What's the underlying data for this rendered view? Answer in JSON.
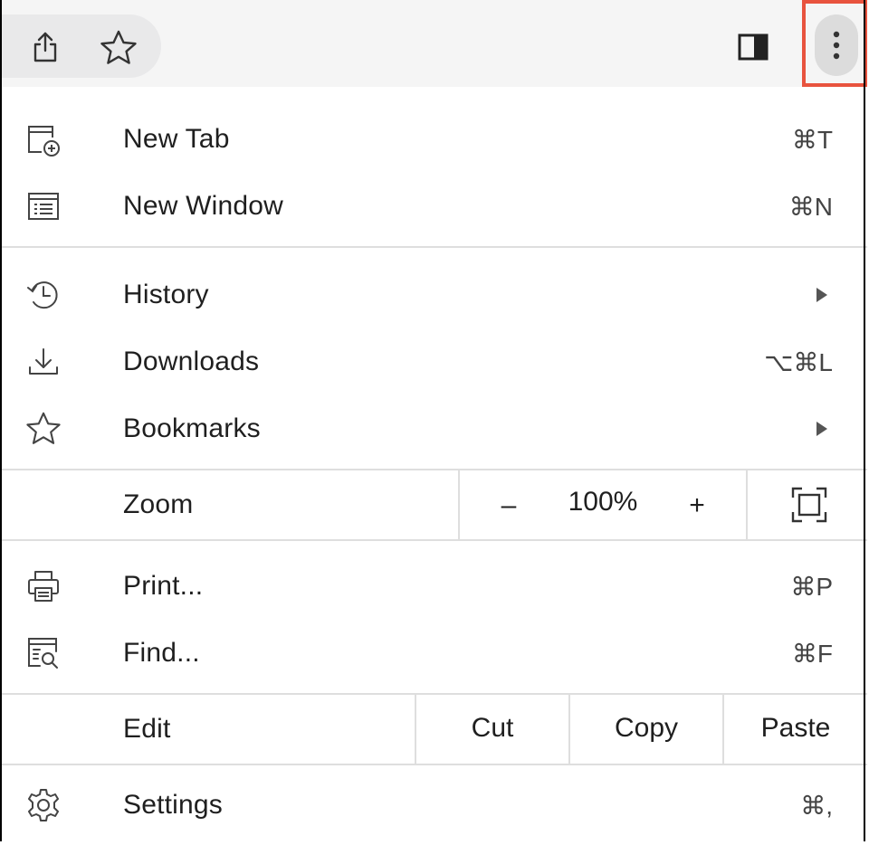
{
  "toolbar": {
    "share_icon": "share-icon",
    "bookmark_icon": "star-icon",
    "side_panel_icon": "side-panel-icon",
    "menu_icon": "kebab-menu-icon",
    "highlight_color": "#e8533e"
  },
  "menu": {
    "new_tab": {
      "label": "New Tab",
      "shortcut": "⌘T",
      "icon": "new-tab-icon"
    },
    "new_window": {
      "label": "New Window",
      "shortcut": "⌘N",
      "icon": "new-window-icon"
    },
    "history": {
      "label": "History",
      "icon": "history-icon"
    },
    "downloads": {
      "label": "Downloads",
      "shortcut": "⌥⌘L",
      "icon": "download-icon"
    },
    "bookmarks": {
      "label": "Bookmarks",
      "icon": "star-icon"
    },
    "zoom": {
      "label": "Zoom",
      "minus": "–",
      "value": "100%",
      "plus": "+",
      "fullscreen_icon": "fullscreen-icon"
    },
    "print": {
      "label": "Print...",
      "shortcut": "⌘P",
      "icon": "print-icon"
    },
    "find": {
      "label": "Find...",
      "shortcut": "⌘F",
      "icon": "find-icon"
    },
    "edit": {
      "label": "Edit",
      "cut": "Cut",
      "copy": "Copy",
      "paste": "Paste"
    },
    "settings": {
      "label": "Settings",
      "shortcut": "⌘,",
      "icon": "gear-icon"
    }
  }
}
